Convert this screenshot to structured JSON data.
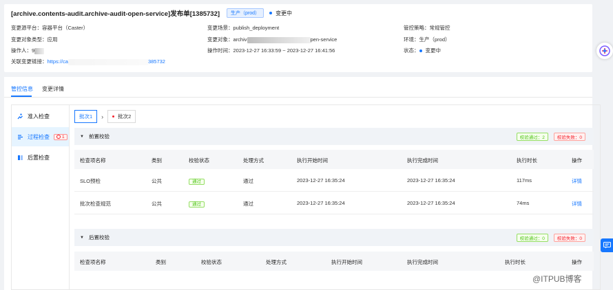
{
  "header": {
    "title": "[archive.contents-audit.archive-audit-open-service]发布单[1385732]",
    "env_tag": "生产（prod）",
    "status": "变更中"
  },
  "info": {
    "platform_k": "变更源平台：",
    "platform_v": "容器平台（Caster）",
    "obj_type_k": "变更对象类型：",
    "obj_type_v": "应用",
    "operator_k": "操作人：",
    "operator_v": "9",
    "link_k": "关联变更链接：",
    "link_v_start": "https://ca",
    "link_v_end": "385732",
    "scene_k": "变更场景：",
    "scene_v": "publish_deployment",
    "object_k": "变更对象：",
    "object_v_start": "archiv",
    "object_v_end": "pen-service",
    "time_k": "操作时间：",
    "time_v": "2023-12-27 16:33:59 ~ 2023-12-27 16:41:56",
    "strategy_k": "管控策略：",
    "strategy_v": "常规管控",
    "env_k": "环境：",
    "env_v": "生产（prod）",
    "state_k": "状态：",
    "state_v": "变更中"
  },
  "tabs": [
    "管控信息",
    "变更详情"
  ],
  "side": {
    "item1": "准入检查",
    "item2": "过程检查",
    "item2_badge": "1",
    "item3": "后置检查"
  },
  "batches": [
    "批次1",
    "批次2"
  ],
  "pre_section": {
    "title": "前置校验",
    "pass": "校验通过：2",
    "fail": "校验失败：0"
  },
  "post_section": {
    "title": "后置校验",
    "pass": "校验通过：0",
    "fail": "校验失败：0"
  },
  "table": {
    "headers": [
      "检查项名称",
      "类别",
      "校验状态",
      "处理方式",
      "执行开始时间",
      "执行完成时间",
      "执行时长",
      "操作"
    ],
    "rows": [
      [
        "SLO预检",
        "公共",
        "通过",
        "通过",
        "2023-12-27 16:35:24",
        "2023-12-27 16:35:24",
        "117ms",
        "详情"
      ],
      [
        "批次检查规范",
        "公共",
        "通过",
        "通过",
        "2023-12-27 16:35:24",
        "2023-12-27 16:35:24",
        "74ms",
        "详情"
      ]
    ]
  },
  "post_headers": [
    "检查项名称",
    "类别",
    "校验状态",
    "处理方式",
    "执行开始时间",
    "执行完成时间",
    "执行时长",
    "操作"
  ],
  "watermark": "@ITPUB博客",
  "colors": {
    "accent": "#1677ff",
    "success": "#52c41a",
    "danger": "#f5222d"
  }
}
